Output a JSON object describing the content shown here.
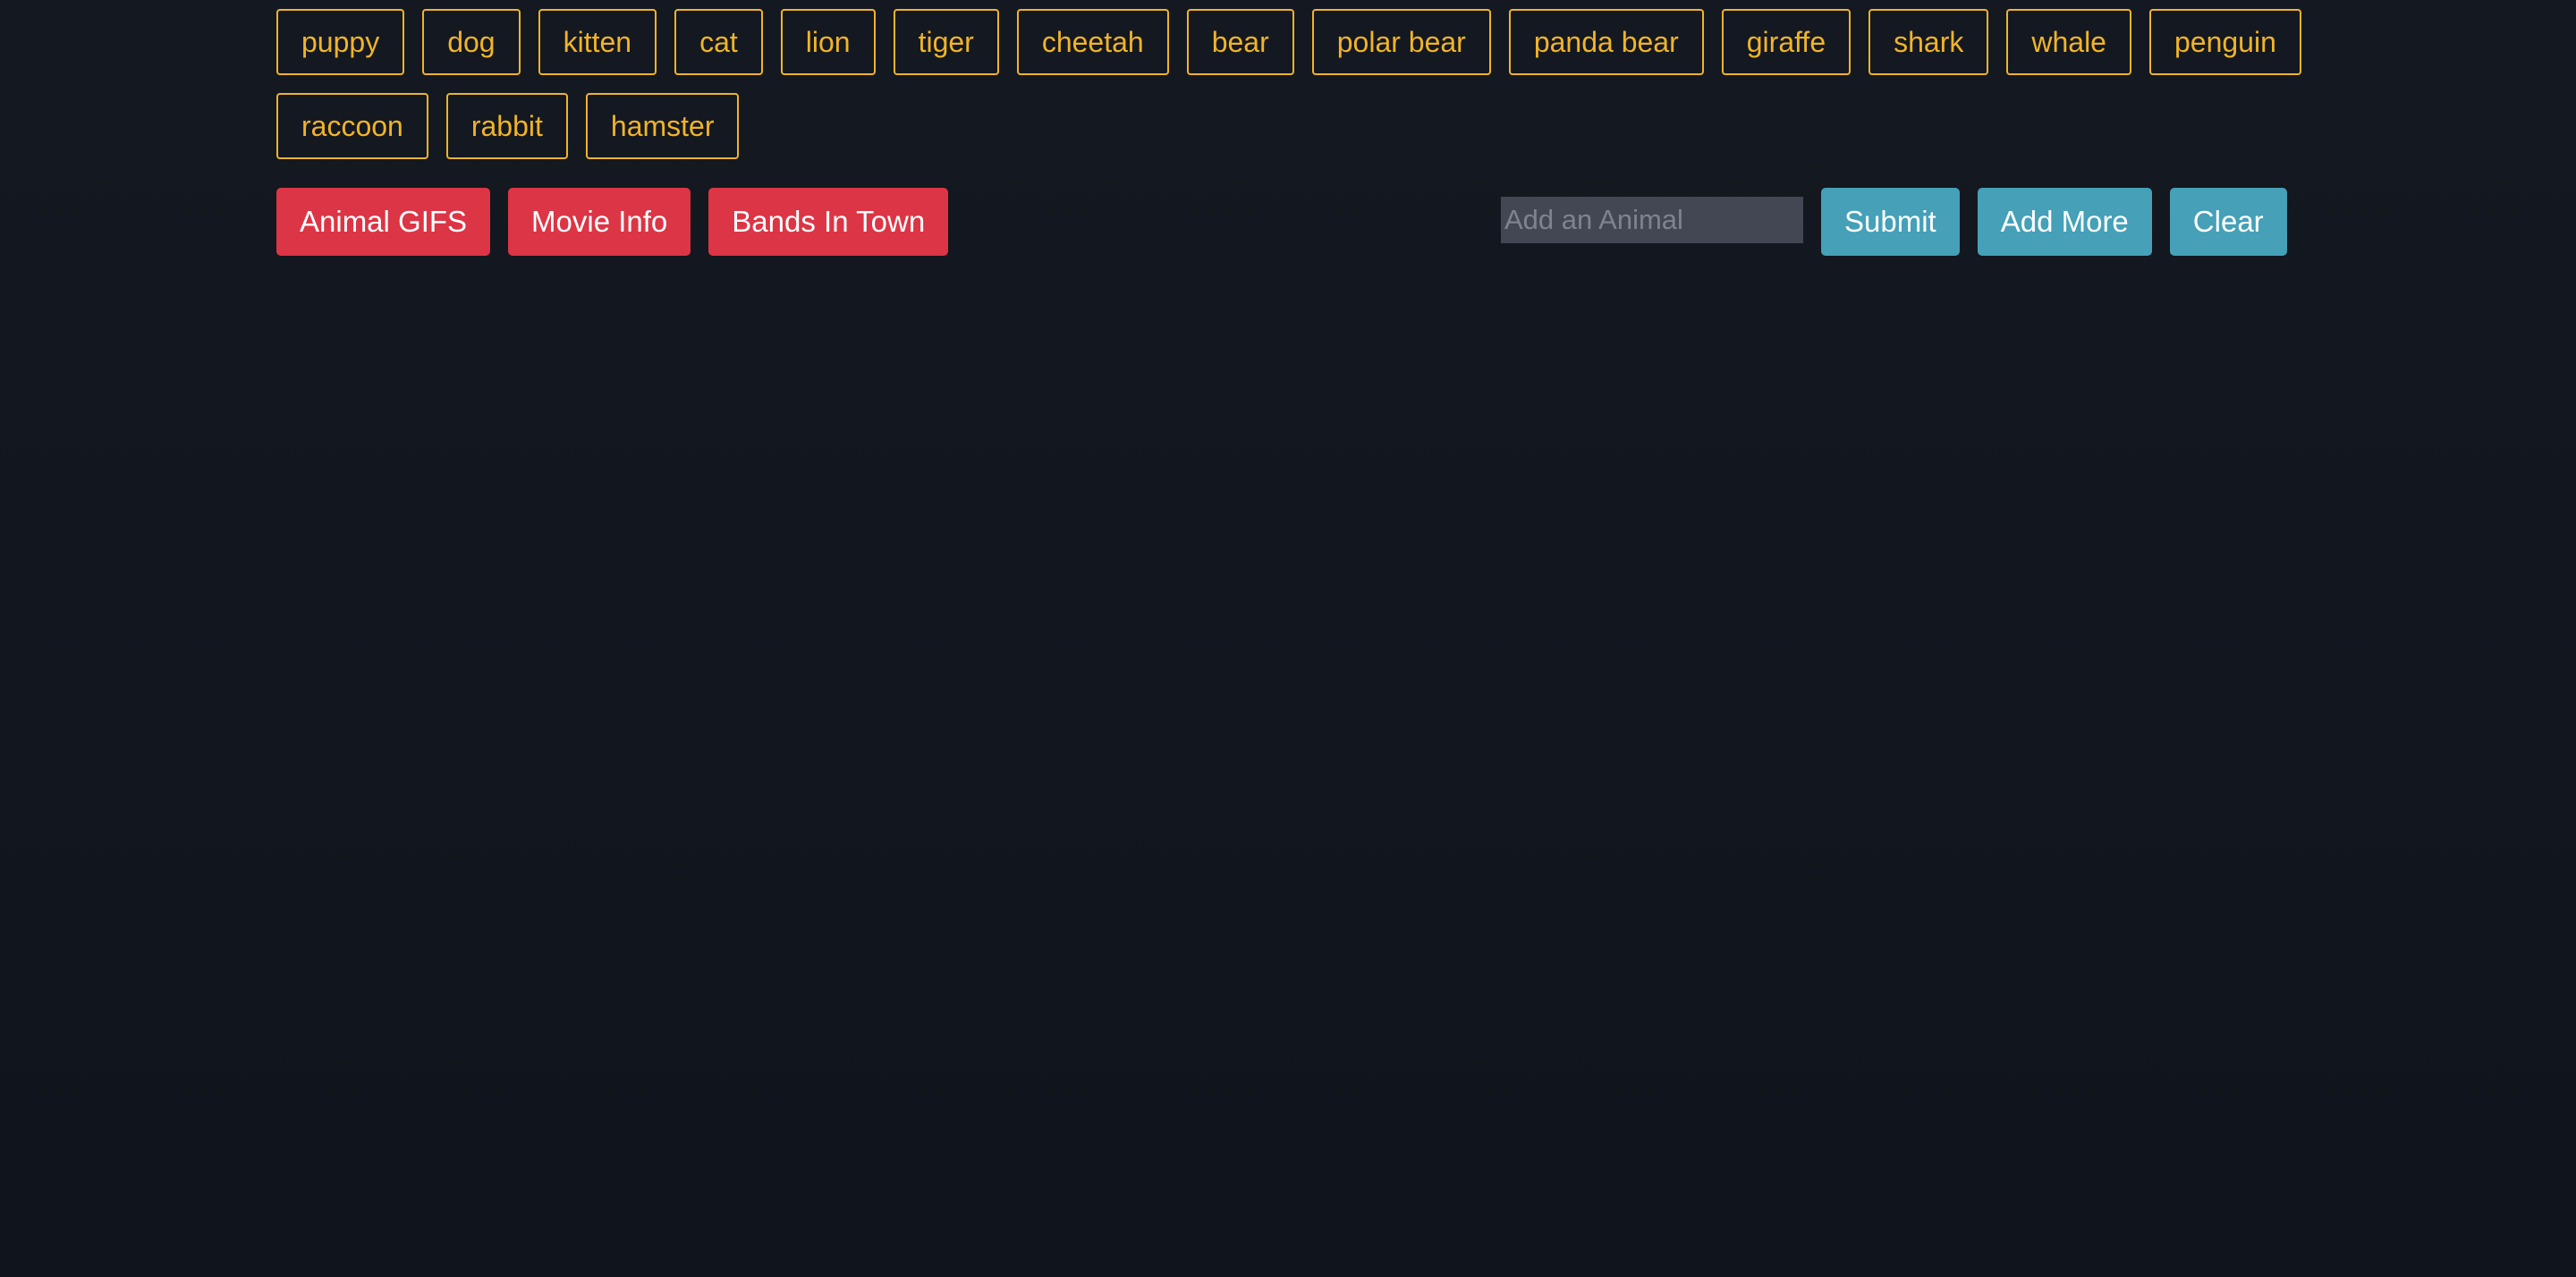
{
  "animals": {
    "items": [
      "puppy",
      "dog",
      "kitten",
      "cat",
      "lion",
      "tiger",
      "cheetah",
      "bear",
      "polar bear",
      "panda bear",
      "giraffe",
      "shark",
      "whale",
      "penguin",
      "raccoon",
      "rabbit",
      "hamster"
    ]
  },
  "nav": {
    "animal_gifs": "Animal GIFS",
    "movie_info": "Movie Info",
    "bands_in_town": "Bands In Town"
  },
  "form": {
    "placeholder": "Add an Animal",
    "value": "",
    "submit": "Submit",
    "add_more": "Add More",
    "clear": "Clear"
  },
  "colors": {
    "background": "#12161f",
    "animal_button": "#f0b429",
    "nav_button": "#dc3545",
    "action_button": "#45a0b8",
    "input_background": "#434754"
  }
}
